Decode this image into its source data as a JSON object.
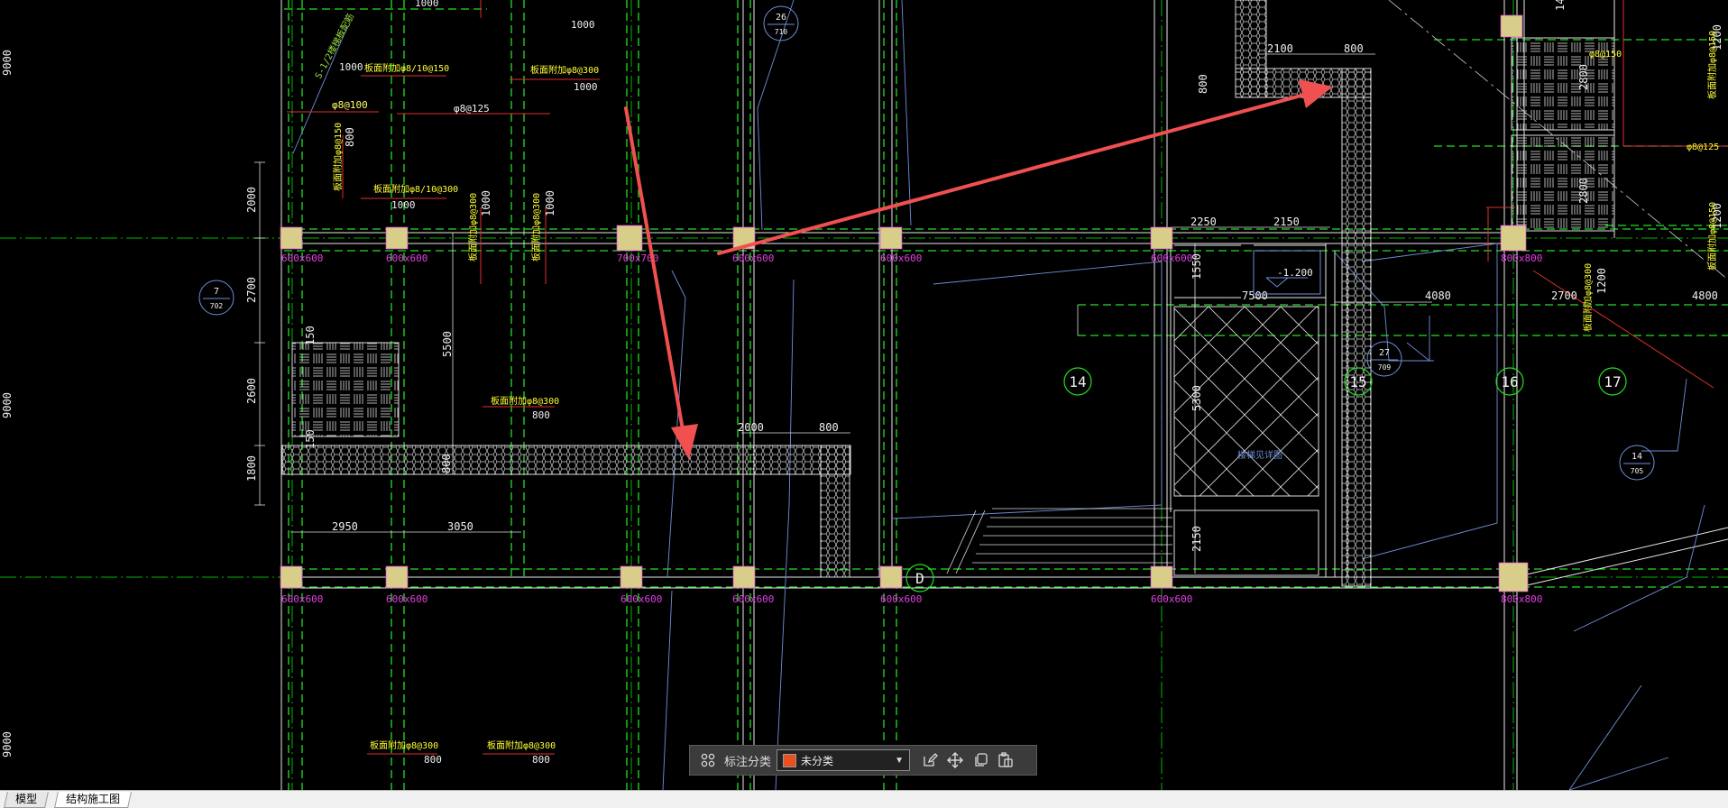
{
  "tabs": [
    {
      "label": "模型",
      "active": false
    },
    {
      "label": "结构施工图",
      "active": true
    }
  ],
  "toolbar": {
    "label": "标注分类",
    "select_value": "未分类",
    "swatch_color": "#e8501e",
    "icons": [
      "grid-icon",
      "edit-icon",
      "move-icon",
      "copy-icon",
      "paste-icon"
    ]
  },
  "drawing": {
    "axis_labels": [
      "14",
      "15",
      "16",
      "17",
      "D"
    ],
    "detail_bubbles": [
      {
        "num": "26",
        "sub": "710"
      },
      {
        "num": "7",
        "sub": "702"
      },
      {
        "num": "27",
        "sub": "709"
      },
      {
        "num": "14",
        "sub": "705"
      }
    ],
    "row_dims_left": [
      "9000",
      "9000",
      "9000"
    ],
    "vertical_dims": [
      "2000",
      "2700",
      "2600",
      "1800",
      "5500",
      "1200",
      "800",
      "800",
      "1550",
      "5300",
      "2150",
      "2800",
      "2800",
      "1200",
      "1200",
      "1000",
      "1000"
    ],
    "horizontal_dims": [
      "2100",
      "800",
      "2250",
      "2150",
      "4080",
      "2700",
      "4800",
      "2000",
      "800",
      "2950",
      "3050",
      "7500"
    ],
    "column_sizes": [
      "600x600",
      "600x600",
      "700x700",
      "600x600",
      "600x600",
      "600x600",
      "800x800",
      "600x600",
      "600x600",
      "600x600",
      "600x600",
      "600x600",
      "600x600",
      "800x800"
    ],
    "rebar_notes": [
      "板面附加φ8/10@150",
      "板面附加φ8@300",
      "板面附加φ8/10@300",
      "φ8@100",
      "φ8@125",
      "板面附加φ8@150",
      "板面附加φ8@300",
      "φ8@150",
      "φ8@125",
      "板面附加φ8@300",
      "板面附加φ8@300"
    ],
    "rebar_lengths": [
      "1000",
      "1000",
      "1000",
      "800",
      "800",
      "800",
      "800"
    ],
    "elevation": "-1.200",
    "note_green": "S-1/2楼梯板配筋",
    "stair_note": "楼梯见详图"
  },
  "colors": {
    "background": "#000000",
    "axis_line": "#00c800",
    "dim_line": "#ffffff",
    "annotation_arrow": "#f05050",
    "column_fill": "#d9cd8a",
    "column_text": "#e040e0",
    "rebar_text": "#ffff00",
    "hatch": "#ffffff",
    "beam_outline": "#6f8fd8"
  }
}
